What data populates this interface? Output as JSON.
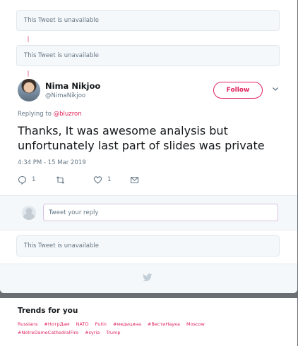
{
  "conversation": {
    "unavailable_1": "This Tweet is unavailable",
    "unavailable_2": "This Tweet is unavailable",
    "unavailable_3": "This Tweet is unavailable"
  },
  "tweet": {
    "name": "Nima Nikjoo",
    "handle": "@NimaNikjoo",
    "follow_label": "Follow",
    "replying_prefix": "Replying to ",
    "replying_to": "@bluzron",
    "text": "Thanks, It was awesome analysis but unfortunately last part of slides was private",
    "timestamp": "4:34 PM - 15 Mar 2019",
    "reply_count": "1",
    "retweet_count": "",
    "like_count": "1"
  },
  "reply_box": {
    "placeholder": "Tweet your reply"
  },
  "trends": {
    "title": "Trends for you",
    "items": [
      "Russians",
      "#НотрДам",
      "NATO",
      "Putin",
      "#медицина",
      "#ВестиНаука",
      "Moscow",
      "#NotreDameCathedralFire",
      "#syria",
      "Trump"
    ]
  },
  "colors": {
    "accent": "#e0245e",
    "overlay": "#6b6e72",
    "muted_text": "#657786"
  },
  "icons": [
    "reply-icon",
    "retweet-icon",
    "like-icon",
    "dm-icon",
    "chevron-down-icon",
    "twitter-bird-icon"
  ]
}
